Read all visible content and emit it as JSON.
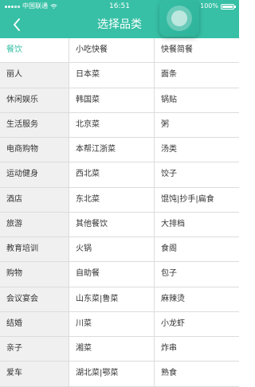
{
  "status_bar": {
    "carrier": "中国联通",
    "time": "16:51",
    "battery": "100%"
  },
  "header": {
    "title": "选择品类"
  },
  "colors": {
    "accent": "#37c0a6"
  },
  "categories": [
    [
      "餐饮",
      "小吃快餐",
      "快餐简餐"
    ],
    [
      "丽人",
      "日本菜",
      "面条"
    ],
    [
      "休闲娱乐",
      "韩国菜",
      "锅贴"
    ],
    [
      "生活服务",
      "北京菜",
      "粥"
    ],
    [
      "电商购物",
      "本帮江浙菜",
      "汤类"
    ],
    [
      "运动健身",
      "西北菜",
      "饺子"
    ],
    [
      "酒店",
      "东北菜",
      "馄饨|抄手|扁食"
    ],
    [
      "旅游",
      "其他餐饮",
      "大排档"
    ],
    [
      "教育培训",
      "火锅",
      "食阁"
    ],
    [
      "购物",
      "自助餐",
      "包子"
    ],
    [
      "会议宴会",
      "山东菜|鲁菜",
      "麻辣烫"
    ],
    [
      "结婚",
      "川菜",
      "小龙虾"
    ],
    [
      "亲子",
      "湘菜",
      "炸串"
    ],
    [
      "爱车",
      "湖北菜|鄂菜",
      "熟食"
    ]
  ]
}
